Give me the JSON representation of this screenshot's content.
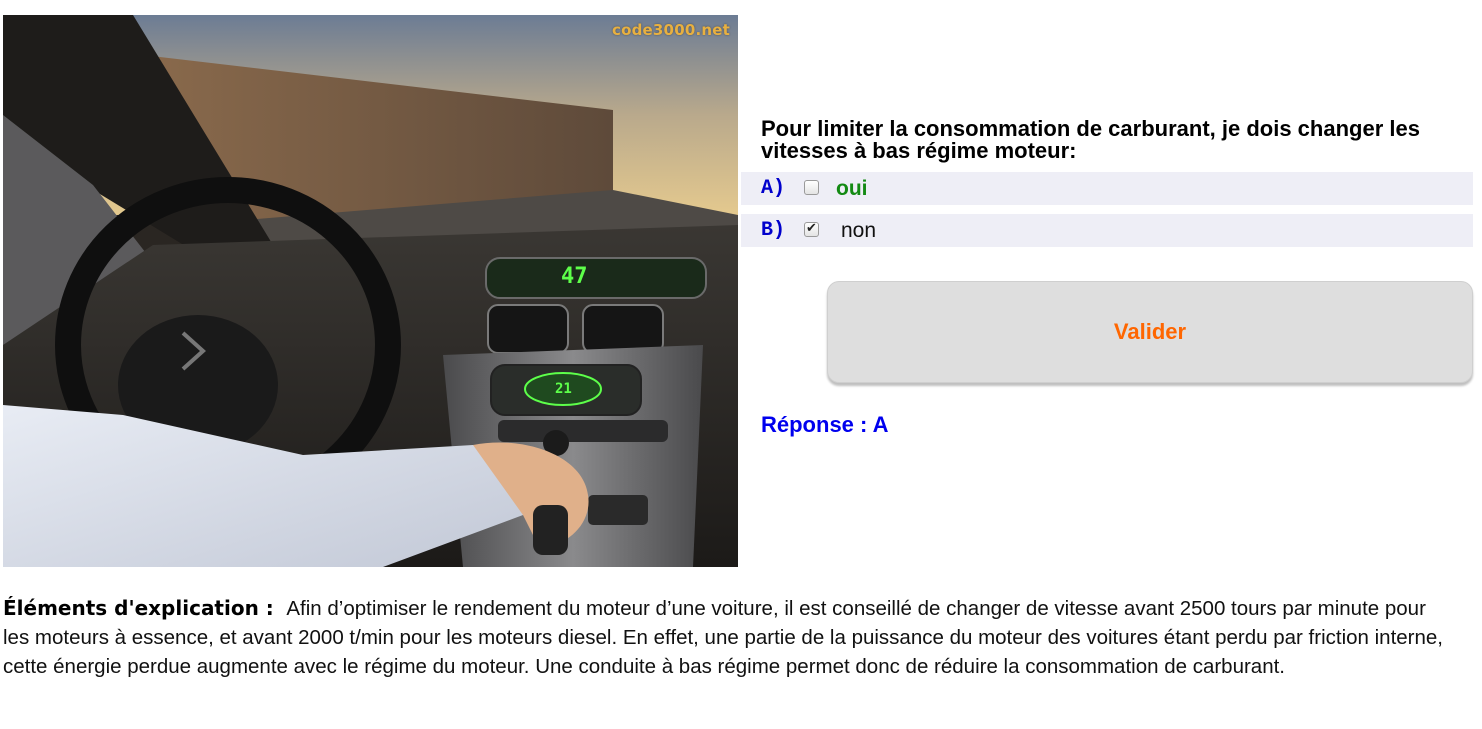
{
  "photo": {
    "watermark": "code3000.net",
    "dash_speed": "47",
    "climate_temp": "21"
  },
  "question": {
    "text": "Pour limiter la consommation de carburant, je dois changer les vitesses à bas régime moteur:"
  },
  "answers": [
    {
      "letter": "A)",
      "label": "oui",
      "checked": false,
      "correct": true
    },
    {
      "letter": "B)",
      "label": "non",
      "checked": true,
      "correct": false
    }
  ],
  "checkmark_glyph": "✔",
  "validate_button": {
    "label": "Valider"
  },
  "response": {
    "text": "Réponse : A"
  },
  "explanation": {
    "label": "Éléments d'explication :",
    "text": "Afin d’optimiser le rendement du moteur d’une voiture, il est conseillé de changer de vitesse avant 2500 tours par minute pour les moteurs à essence, et avant 2000 t/min pour les moteurs diesel. En effet, une partie de la puissance du moteur des voitures étant perdu par friction interne, cette énergie perdue augmente avec le régime du moteur. Une conduite à bas régime permet donc de réduire la consommation de carburant."
  },
  "colors": {
    "answer_letter": "#0000cc",
    "correct_answer": "#138a13",
    "button_text": "#ff6600",
    "response_text": "#0000ee",
    "row_background": "#eeeef6"
  }
}
